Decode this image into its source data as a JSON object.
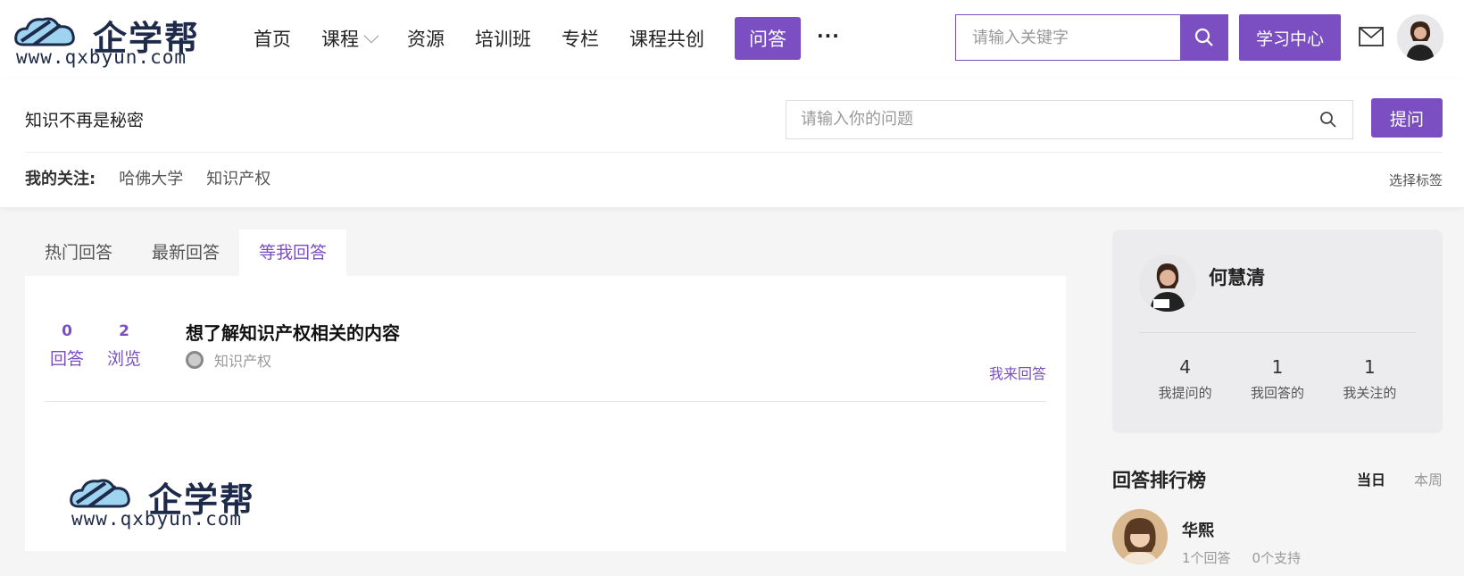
{
  "header": {
    "logo_text": "企学帮",
    "logo_url": "www.qxbyun.com",
    "nav": [
      {
        "label": "首页"
      },
      {
        "label": "课程"
      },
      {
        "label": "资源"
      },
      {
        "label": "培训班"
      },
      {
        "label": "专栏"
      },
      {
        "label": "课程共创"
      },
      {
        "label": "问答"
      }
    ],
    "more": "···",
    "search_placeholder": "请输入关键字",
    "learn_center": "学习中心"
  },
  "subheader": {
    "slogan": "知识不再是秘密",
    "question_placeholder": "请输入你的问题",
    "ask_button": "提问",
    "follow_label": "我的关注:",
    "follow_tags": [
      "哈佛大学",
      "知识产权"
    ],
    "choose_tag": "选择标签"
  },
  "main": {
    "tabs": [
      {
        "label": "热门回答"
      },
      {
        "label": "最新回答"
      },
      {
        "label": "等我回答"
      }
    ],
    "questions": [
      {
        "answers": "0",
        "answers_label": "回答",
        "views": "2",
        "views_label": "浏览",
        "title": "想了解知识产权相关的内容",
        "tag": "知识产权",
        "answer_action": "我来回答"
      }
    ]
  },
  "sidebar": {
    "profile": {
      "name": "何慧清",
      "stats": [
        {
          "num": "4",
          "label": "我提问的"
        },
        {
          "num": "1",
          "label": "我回答的"
        },
        {
          "num": "1",
          "label": "我关注的"
        }
      ]
    },
    "ranking": {
      "title": "回答排行榜",
      "tab_today": "当日",
      "tab_week": "本周",
      "items": [
        {
          "name": "华熙",
          "answers": "1个回答",
          "support": "0个支持"
        }
      ]
    }
  },
  "colors": {
    "accent": "#7b4fc2"
  }
}
